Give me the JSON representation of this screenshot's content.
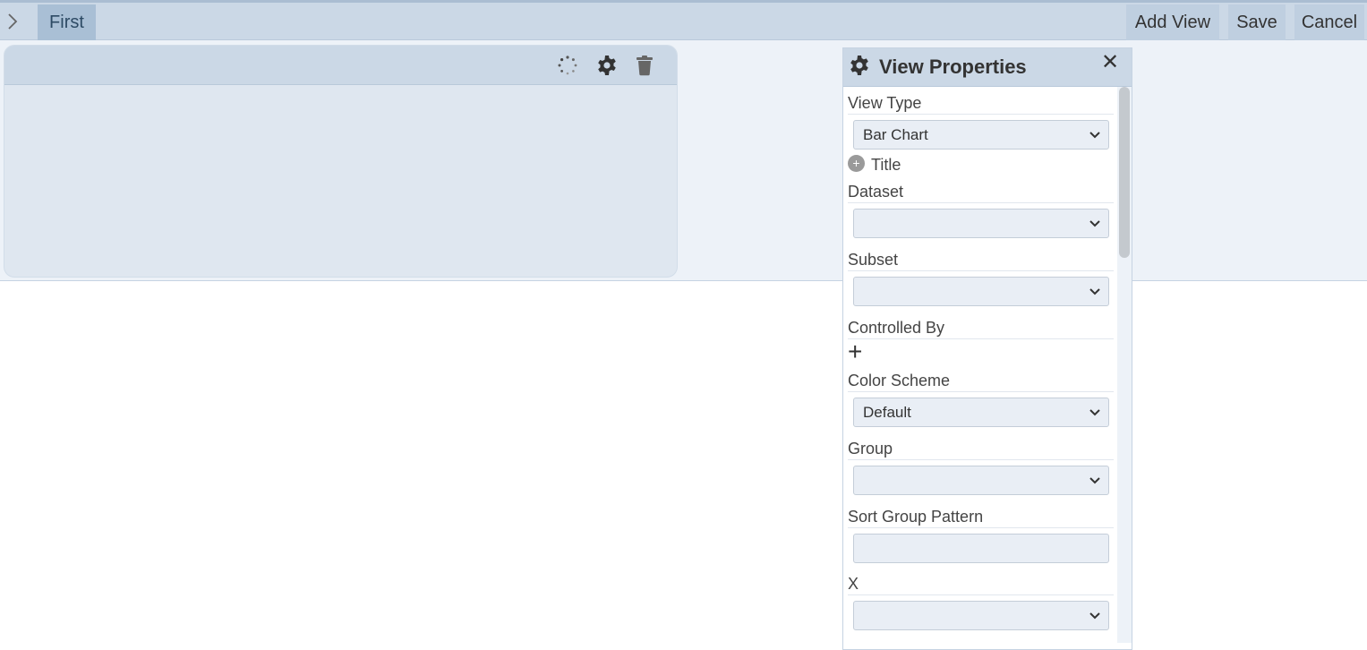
{
  "toolbar": {
    "expand_icon": "chevron-right-icon",
    "tab_label": "First",
    "add_view_label": "Add View",
    "save_label": "Save",
    "cancel_label": "Cancel"
  },
  "widget": {
    "icons": [
      "loading-spinner-icon",
      "gear-icon",
      "trash-icon"
    ]
  },
  "panel": {
    "title": "View Properties",
    "close_glyph": "✕",
    "fields": {
      "view_type": {
        "label": "View Type",
        "value": "Bar Chart"
      },
      "title": {
        "label": "Title"
      },
      "dataset": {
        "label": "Dataset",
        "value": ""
      },
      "subset": {
        "label": "Subset",
        "value": ""
      },
      "controlled_by": {
        "label": "Controlled By",
        "add_glyph": "+"
      },
      "color_scheme": {
        "label": "Color Scheme",
        "value": "Default"
      },
      "group": {
        "label": "Group",
        "value": ""
      },
      "sort_group_pattern": {
        "label": "Sort Group Pattern",
        "value": ""
      },
      "x": {
        "label": "X",
        "value": ""
      }
    }
  },
  "colors": {
    "topbar": "#cbd8e6",
    "tab_active": "#a9bfd5",
    "workspace": "#edf2f8",
    "widget": "#dfe7f0"
  }
}
